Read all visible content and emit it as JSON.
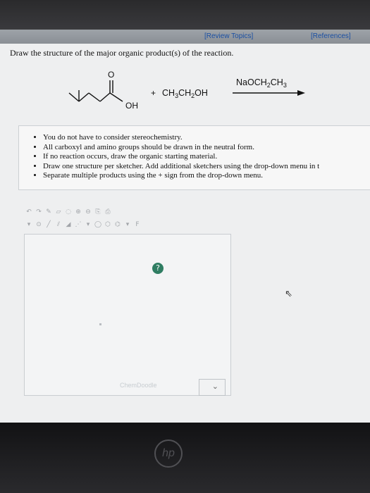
{
  "header": {
    "review_label": "[Review Topics]",
    "references_label": "[References]"
  },
  "question": {
    "prompt": "Draw the structure of the major organic product(s) of the reaction."
  },
  "reaction": {
    "reactant_o": "O",
    "reactant_oh": "OH",
    "plus": "+",
    "reagent2": "CH3CH2OH",
    "reagent2_segments": [
      "CH",
      "3",
      "CH",
      "2",
      "OH"
    ],
    "conditions": "NaOCH2CH3",
    "conditions_segments": [
      "NaOCH",
      "2",
      "CH",
      "3"
    ]
  },
  "notes": {
    "items": [
      "You do not have to consider stereochemistry.",
      "All carboxyl and amino groups should be drawn in the neutral form.",
      "If no reaction occurs, draw the organic starting material.",
      "Draw one structure per sketcher. Add additional sketchers using the drop-down menu in t",
      "Separate multiple products using the + sign from the drop-down menu."
    ]
  },
  "sketcher": {
    "help_label": "?",
    "brand_label": "ChemDoodle",
    "dropdown_label": "⌄"
  },
  "device": {
    "logo": "hp"
  }
}
